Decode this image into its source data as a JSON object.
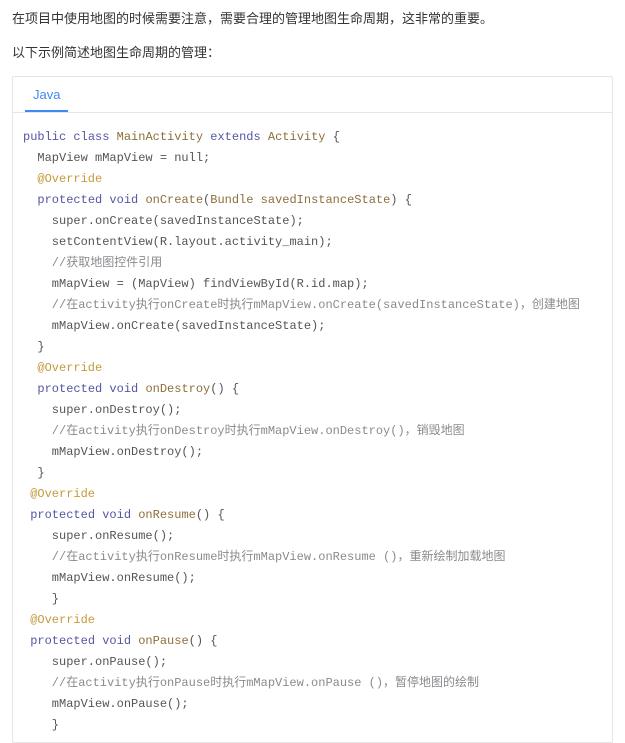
{
  "intro": {
    "p1": "在项目中使用地图的时候需要注意，需要合理的管理地图生命周期，这非常的重要。",
    "p2": "以下示例简述地图生命周期的管理："
  },
  "tabs": {
    "active": "Java"
  },
  "code": {
    "l01": {
      "kw1": "public",
      "kw2": "class",
      "name": "MainActivity",
      "kw3": "extends",
      "sup": "Activity",
      "brace": " {"
    },
    "l02": "  MapView mMapView = null;",
    "l03": "  @Override",
    "l04": {
      "pre": "  ",
      "kw1": "protected",
      "kw2": "void",
      "fn": "onCreate",
      "po": "(",
      "t1": "Bundle",
      "sp": " ",
      "t2": "savedInstanceState",
      "pc": ")",
      "tail": " {"
    },
    "l05": "    super.onCreate(savedInstanceState);",
    "l06": "    setContentView(R.layout.activity_main);",
    "l07": "    //获取地图控件引用",
    "l08": "    mMapView = (MapView) findViewById(R.id.map);",
    "l09": "    //在activity执行onCreate时执行mMapView.onCreate(savedInstanceState)，创建地图",
    "l10": "    mMapView.onCreate(savedInstanceState);",
    "l11": "  }",
    "l12": "  @Override",
    "l13": {
      "pre": "  ",
      "kw1": "protected",
      "kw2": "void",
      "fn": "onDestroy",
      "po": "()",
      "tail": " {"
    },
    "l14": "    super.onDestroy();",
    "l15": "    //在activity执行onDestroy时执行mMapView.onDestroy()，销毁地图",
    "l16": "    mMapView.onDestroy();",
    "l17": "  }",
    "l18": " @Override",
    "l19": {
      "pre": " ",
      "kw1": "protected",
      "kw2": "void",
      "fn": "onResume",
      "po": "()",
      "tail": " {"
    },
    "l20": "    super.onResume();",
    "l21": "    //在activity执行onResume时执行mMapView.onResume ()，重新绘制加载地图",
    "l22": "    mMapView.onResume();",
    "l23": "    }",
    "l24": " @Override",
    "l25": {
      "pre": " ",
      "kw1": "protected",
      "kw2": "void",
      "fn": "onPause",
      "po": "()",
      "tail": " {"
    },
    "l26": "    super.onPause();",
    "l27": "    //在activity执行onPause时执行mMapView.onPause ()，暂停地图的绘制",
    "l28": "    mMapView.onPause();",
    "l29": "    }"
  }
}
